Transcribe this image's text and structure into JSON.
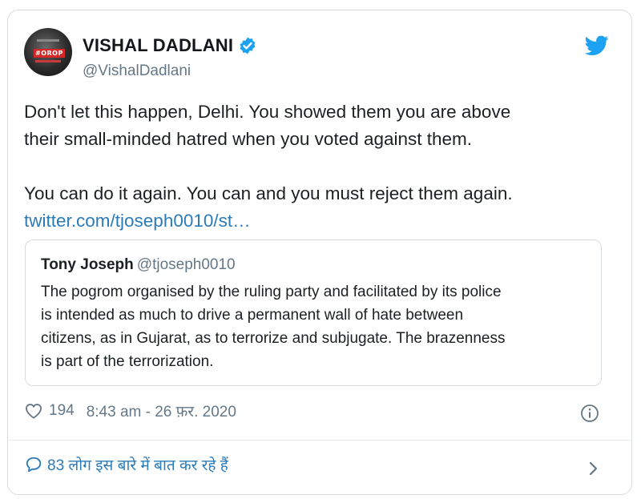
{
  "author": {
    "display_name": "VISHAL DADLANI",
    "handle": "@VishalDadlani",
    "avatar_text": "#OROP"
  },
  "tweet": {
    "line1": "Don't let this happen, Delhi. You showed them you are above",
    "line2": "their small-minded hatred when you voted against them.",
    "line3": "You can do it again. You can and you must reject them again.",
    "link": "twitter.com/tjoseph0010/st…"
  },
  "quote": {
    "name": "Tony Joseph",
    "handle": "@tjoseph0010",
    "line1": "The pogrom organised by the ruling party and facilitated by its police",
    "line2": "is intended as much to drive a permanent wall of hate between",
    "line3": "citizens, as in Gujarat, as to terrorize and subjugate. The brazenness",
    "line4": "is part of the terrorization."
  },
  "meta": {
    "like_count": "194",
    "timestamp": "8:43 am - 26 फ़र. 2020"
  },
  "footer": {
    "conversation_text": "83 लोग इस बारे में बात कर रहे हैं"
  },
  "colors": {
    "twitter_blue": "#1da1f2",
    "link_blue": "#2b7bb9",
    "secondary_gray": "#657786"
  }
}
